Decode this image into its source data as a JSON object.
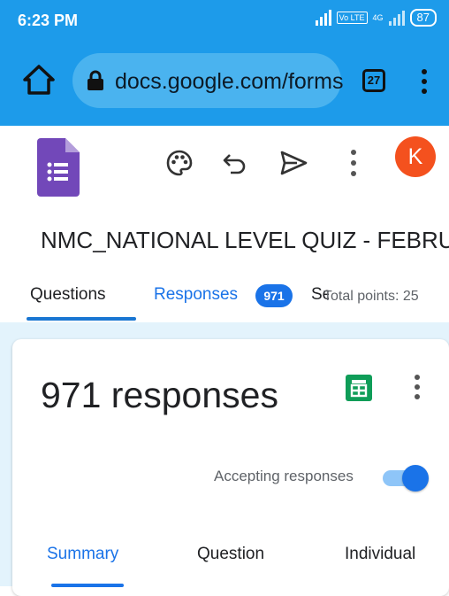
{
  "status_bar": {
    "time": "6:23 PM",
    "volte_label": "Vo LTE",
    "network_label": "4G",
    "battery": "87"
  },
  "browser": {
    "url": "docs.google.com/forms",
    "tab_count": "27"
  },
  "toolbar": {
    "avatar_initial": "K"
  },
  "form": {
    "title": "NMC_NATIONAL LEVEL QUIZ - FEBRUARY"
  },
  "tabs": {
    "questions": "Questions",
    "responses": "Responses",
    "responses_badge": "971",
    "settings": "Settings",
    "total_points": "Total points: 25"
  },
  "responses_card": {
    "count_label": "971 responses",
    "accepting_label": "Accepting responses",
    "accepting_on": true
  },
  "subtabs": {
    "summary": "Summary",
    "question": "Question",
    "individual": "Individual"
  },
  "colors": {
    "browser_bar": "#1d9bea",
    "accent": "#1a73e8",
    "forms_purple": "#7248b9",
    "avatar": "#f4511e",
    "sheets_green": "#0f9d58"
  }
}
